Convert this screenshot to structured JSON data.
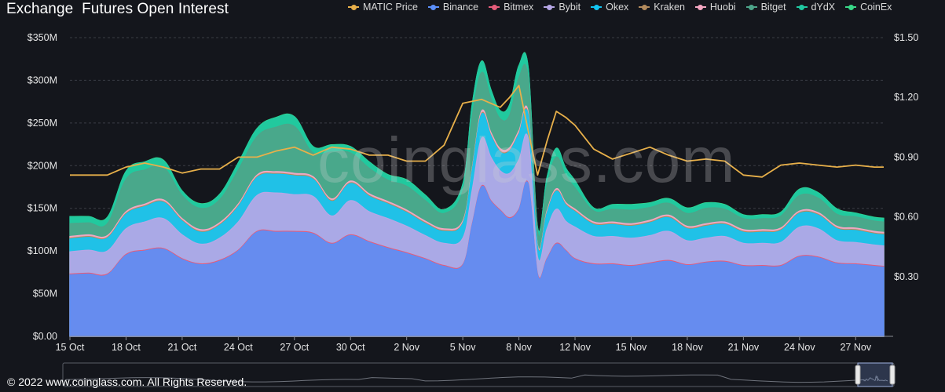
{
  "header": {
    "title": "Exchange  Futures Open Interest"
  },
  "watermark": "coinglass.com",
  "footer": {
    "copyright": "© 2022 www.coinglass.com. All Rights Reserved."
  },
  "colors": {
    "background": "#14161c",
    "grid": "#3a3d45",
    "axis_text": "#e6e6e6",
    "price_line": "#e8b04a"
  },
  "chart_data": {
    "type": "area",
    "stacked": true,
    "title": "Exchange  Futures Open Interest",
    "x_tick_labels": [
      "15 Oct",
      "18 Oct",
      "21 Oct",
      "24 Oct",
      "27 Oct",
      "30 Oct",
      "2 Nov",
      "5 Nov",
      "8 Nov",
      "12 Nov",
      "15 Nov",
      "18 Nov",
      "21 Nov",
      "24 Nov",
      "27 Nov"
    ],
    "y_left": {
      "ticks": [
        "$0.00",
        "$50M",
        "$100M",
        "$150M",
        "$200M",
        "$250M",
        "$300M",
        "$350M"
      ],
      "range": [
        0,
        350
      ]
    },
    "y_right": {
      "ticks": [
        "$0.30",
        "$0.60",
        "$0.90",
        "$1.20",
        "$1.50"
      ],
      "range": [
        0,
        1.5
      ]
    },
    "legend_position": "top-right",
    "grid": true,
    "x_day_offsets": [
      0,
      1,
      2,
      3,
      4,
      5,
      6,
      7,
      8,
      9,
      10,
      11,
      12,
      13,
      14,
      15,
      16,
      17,
      18,
      19,
      20,
      21,
      21.5,
      22,
      22.5,
      23,
      23.5,
      24,
      24.5,
      25,
      25.5,
      26,
      26.5,
      27,
      28,
      29,
      30,
      31,
      32,
      33,
      34,
      35,
      36,
      37,
      38,
      39,
      40,
      41,
      42,
      43,
      43.5
    ],
    "series": [
      {
        "name": "MATIC Price",
        "color": "#e8b04a",
        "axis": "right",
        "type": "line",
        "values": [
          0.81,
          0.81,
          0.81,
          0.85,
          0.87,
          0.85,
          0.82,
          0.84,
          0.84,
          0.9,
          0.9,
          0.93,
          0.95,
          0.91,
          0.95,
          0.94,
          0.91,
          0.91,
          0.88,
          0.88,
          0.96,
          1.17,
          1.18,
          1.19,
          1.17,
          1.15,
          1.2,
          1.26,
          1.03,
          0.81,
          0.98,
          1.13,
          1.1,
          1.06,
          0.94,
          0.89,
          0.92,
          0.95,
          0.91,
          0.88,
          0.89,
          0.88,
          0.81,
          0.8,
          0.86,
          0.87,
          0.86,
          0.85,
          0.86,
          0.85,
          0.85
        ]
      },
      {
        "name": "Binance",
        "color": "#5b8ff9",
        "axis": "left",
        "type": "area",
        "values": [
          72,
          73,
          72,
          95,
          100,
          102,
          90,
          84,
          88,
          100,
          122,
          122,
          122,
          120,
          108,
          118,
          110,
          103,
          97,
          90,
          82,
          83,
          130,
          175,
          158,
          147,
          138,
          148,
          178,
          72,
          90,
          108,
          100,
          90,
          84,
          84,
          82,
          85,
          88,
          83,
          86,
          87,
          82,
          82,
          82,
          93,
          92,
          85,
          84,
          82,
          81
        ]
      },
      {
        "name": "Bitmex",
        "color": "#e45c7a",
        "axis": "left",
        "type": "area",
        "values": [
          1,
          1,
          1,
          1,
          1,
          1,
          1,
          1,
          1,
          1,
          1,
          1,
          1,
          1,
          1,
          1,
          1,
          1,
          1,
          1,
          1,
          1,
          1,
          1,
          1,
          1,
          1,
          1,
          1,
          1,
          1,
          1,
          1,
          1,
          1,
          1,
          1,
          1,
          1,
          1,
          1,
          1,
          1,
          1,
          1,
          1,
          1,
          1,
          1,
          1,
          1
        ]
      },
      {
        "name": "Bybit",
        "color": "#b6a7e6",
        "axis": "left",
        "type": "area",
        "values": [
          26,
          27,
          27,
          30,
          33,
          35,
          28,
          23,
          26,
          33,
          42,
          45,
          43,
          43,
          32,
          40,
          35,
          34,
          31,
          27,
          26,
          31,
          40,
          56,
          51,
          46,
          52,
          58,
          52,
          20,
          35,
          40,
          34,
          37,
          32,
          32,
          32,
          32,
          34,
          28,
          28,
          29,
          26,
          26,
          27,
          34,
          33,
          26,
          25,
          24,
          24
        ]
      },
      {
        "name": "Okex",
        "color": "#12c5f2",
        "axis": "left",
        "type": "area",
        "values": [
          15,
          15,
          15,
          17,
          18,
          19,
          16,
          14,
          15,
          18,
          21,
          22,
          22,
          20,
          17,
          20,
          18,
          17,
          16,
          14,
          14,
          17,
          23,
          28,
          25,
          22,
          26,
          30,
          27,
          11,
          18,
          21,
          19,
          18,
          14,
          14,
          14,
          15,
          16,
          14,
          14,
          14,
          13,
          13,
          14,
          16,
          16,
          14,
          14,
          13,
          13
        ]
      },
      {
        "name": "Kraken",
        "color": "#b38b5d",
        "axis": "left",
        "type": "area",
        "values": [
          1,
          1,
          1,
          1,
          1,
          1,
          1,
          1,
          1,
          1,
          1,
          1,
          1,
          1,
          1,
          1,
          1,
          1,
          1,
          1,
          1,
          1,
          1,
          1,
          1,
          1,
          1,
          1,
          1,
          1,
          1,
          1,
          1,
          1,
          1,
          1,
          1,
          1,
          1,
          1,
          1,
          1,
          1,
          1,
          1,
          1,
          1,
          1,
          1,
          1,
          1
        ]
      },
      {
        "name": "Huobi",
        "color": "#f4a7c2",
        "axis": "left",
        "type": "area",
        "values": [
          2,
          2,
          2,
          2,
          2,
          2,
          2,
          2,
          2,
          2,
          2,
          2,
          2,
          2,
          2,
          2,
          2,
          2,
          2,
          2,
          2,
          2,
          2,
          3,
          3,
          3,
          3,
          3,
          3,
          2,
          2,
          2,
          2,
          2,
          2,
          2,
          2,
          2,
          2,
          2,
          2,
          2,
          2,
          2,
          2,
          2,
          2,
          2,
          2,
          2,
          2
        ]
      },
      {
        "name": "Bitget",
        "color": "#4da58a",
        "axis": "left",
        "type": "area",
        "values": [
          15,
          14,
          14,
          38,
          40,
          38,
          27,
          25,
          27,
          40,
          45,
          52,
          55,
          28,
          55,
          33,
          30,
          25,
          28,
          24,
          18,
          35,
          60,
          45,
          40,
          35,
          38,
          62,
          40,
          15,
          30,
          37,
          31,
          25,
          13,
          15,
          16,
          15,
          14,
          15,
          18,
          15,
          13,
          13,
          14,
          18,
          17,
          14,
          13,
          12,
          12
        ]
      },
      {
        "name": "dYdX",
        "color": "#20c9a1",
        "axis": "left",
        "type": "area",
        "values": [
          8,
          7,
          7,
          9,
          9,
          8,
          5,
          5,
          6,
          8,
          9,
          11,
          11,
          7,
          8,
          7,
          7,
          6,
          7,
          6,
          4,
          8,
          14,
          13,
          10,
          9,
          12,
          14,
          12,
          5,
          9,
          10,
          9,
          8,
          3,
          5,
          6,
          5,
          5,
          6,
          6,
          5,
          4,
          4,
          4,
          7,
          6,
          6,
          4,
          4,
          4
        ]
      },
      {
        "name": "CoinEx",
        "color": "#39d888",
        "axis": "left",
        "type": "area",
        "values": [
          0.5,
          0.5,
          0.5,
          0.5,
          0.5,
          0.5,
          0.5,
          0.5,
          0.5,
          0.5,
          0.5,
          0.5,
          0.5,
          0.5,
          0.5,
          0.5,
          0.5,
          0.5,
          0.5,
          0.5,
          0.5,
          0.5,
          0.5,
          0.5,
          0.5,
          0.5,
          0.5,
          0.5,
          0.5,
          0.5,
          0.5,
          0.5,
          0.5,
          0.5,
          0.5,
          0.5,
          0.5,
          0.5,
          0.5,
          0.5,
          0.5,
          0.5,
          0.5,
          0.5,
          0.5,
          0.5,
          0.5,
          0.5,
          0.5,
          0.5,
          0.5
        ]
      }
    ]
  }
}
